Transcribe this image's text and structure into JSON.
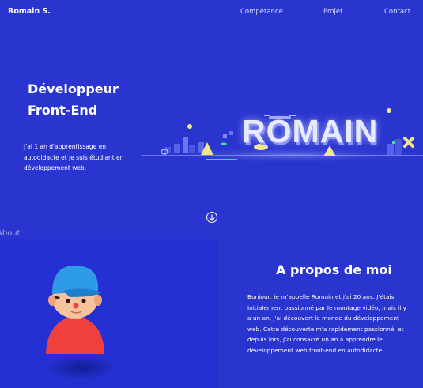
{
  "nav": {
    "brand": "Romain S.",
    "links": [
      "Compétance",
      "Projet",
      "Contact"
    ]
  },
  "hero": {
    "title_line1": "Développeur",
    "title_line2": "Front-End",
    "description": "J'ai 1 an d'apprentissage en autodidacte et je suis étudiant en développement web.",
    "scene_word": "ROMAIN"
  },
  "about": {
    "tab_label": "About",
    "title": "A propos de moi",
    "text": "Bonjour, je m'appelle Romain et j'ai 20 ans. J'étais initialement passionné par le montage vidéo, mais il y a un an, j'ai découvert le monde du développement web. Cette découverte m'a rapidement passionné, et depuis lors, j'ai consacré un an à apprendre le développement web front-end en autodidacte."
  },
  "colors": {
    "background": "#2a34cf",
    "accent_red": "#f0403e",
    "accent_blue": "#2e9be8"
  },
  "icons": {
    "scroll": "arrow-down-circle-icon"
  }
}
